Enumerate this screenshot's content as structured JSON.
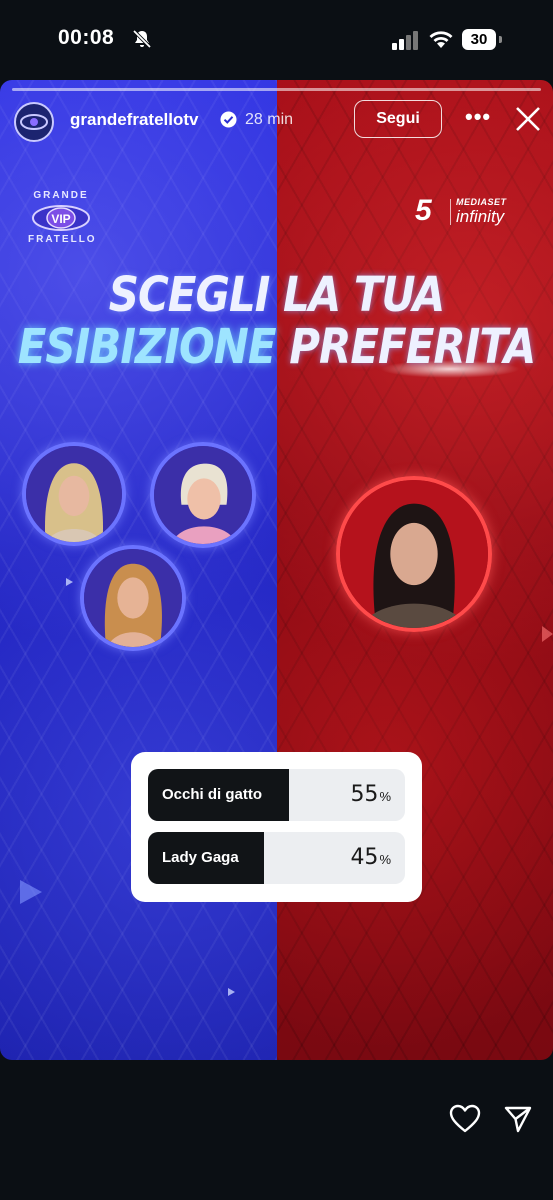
{
  "status_bar": {
    "time": "00:08",
    "battery": "30",
    "icons": [
      "bell-muted-icon",
      "cellular-signal-icon",
      "wifi-icon",
      "battery-icon"
    ]
  },
  "story": {
    "username": "grandefratellotv",
    "verified": true,
    "time_ago": "28 min",
    "follow_label": "Segui",
    "more_label": "•••",
    "avatar_text": "GRANDE FRATELLO",
    "logo": {
      "line1": "GRANDE",
      "center": "VIP",
      "line2": "FRATELLO"
    },
    "channel": {
      "number": "5",
      "line1": "MEDIASET",
      "line2": "infinity"
    },
    "headline_line1": "SCEGLI LA TUA",
    "headline_line2_a": "ESIBIZIONE",
    "headline_line2_b": "PREFERITA",
    "colors": {
      "left": "#2326c4",
      "right": "#8c0a14",
      "poll_fill": "#111417"
    }
  },
  "poll": {
    "options": [
      {
        "label": "Occhi di gatto",
        "percent": 55,
        "percent_text": "55",
        "symbol": "%"
      },
      {
        "label": "Lady Gaga",
        "percent": 45,
        "percent_text": "45",
        "symbol": "%"
      }
    ]
  },
  "actions": {
    "icons": [
      "heart-icon",
      "send-icon"
    ]
  }
}
